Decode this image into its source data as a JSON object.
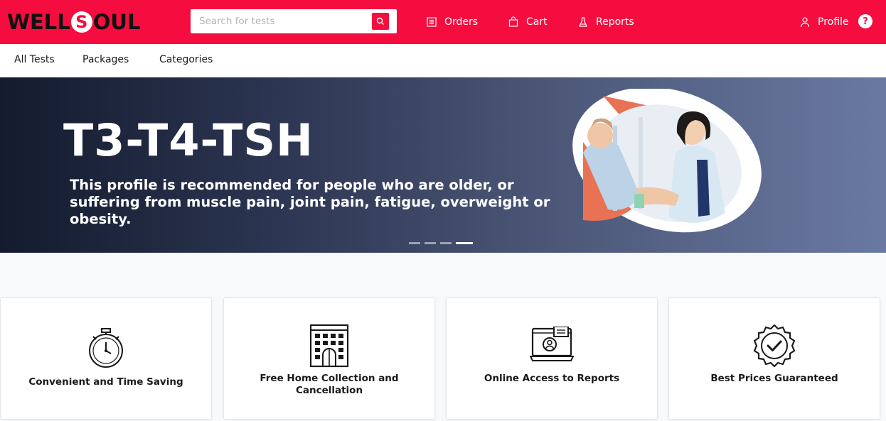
{
  "brand": {
    "logo_left": "WELL",
    "logo_s": "S",
    "logo_right": "OUL",
    "primary_color": "#f50d3f"
  },
  "header": {
    "search": {
      "placeholder": "Search for tests",
      "value": ""
    },
    "nav": {
      "orders": "Orders",
      "cart": "Cart",
      "reports": "Reports",
      "profile": "Profile",
      "help": "?"
    }
  },
  "subnav": {
    "items": [
      "All Tests",
      "Packages",
      "Categories"
    ]
  },
  "banner": {
    "title": "T3-T4-TSH",
    "subtitle_line1": "This profile is recommended for people who are older, or",
    "subtitle_line2": "suffering from muscle pain, joint pain, fatigue, overweight or obesity.",
    "slides": 4,
    "active_slide": 4
  },
  "features": [
    {
      "icon": "stopwatch-icon",
      "label": "Convenient and Time Saving"
    },
    {
      "icon": "building-icon",
      "label_line1": "Free Home Collection and",
      "label_line2": "Cancellation"
    },
    {
      "icon": "online-report-icon",
      "label": "Online Access to Reports"
    },
    {
      "icon": "badge-check-icon",
      "label": "Best Prices Guaranteed"
    }
  ]
}
